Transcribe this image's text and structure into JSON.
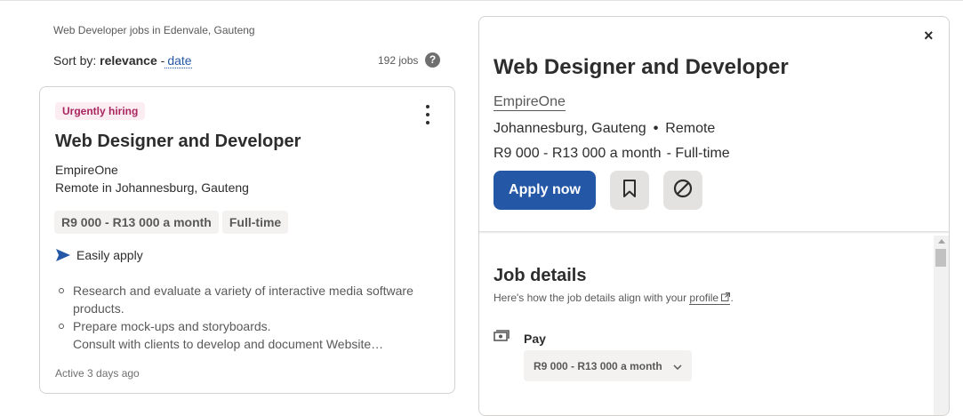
{
  "search": {
    "title": "Web Developer jobs in Edenvale, Gauteng",
    "sort_prefix": "Sort by:",
    "sort_active": "relevance",
    "sort_separator": " -",
    "sort_alt": "date",
    "job_count": "192 jobs",
    "help_glyph": "?"
  },
  "card": {
    "badge": "Urgently hiring",
    "title": "Web Designer and Developer",
    "company": "EmpireOne",
    "location": "Remote in Johannesburg, Gauteng",
    "tags": [
      "R9 000 - R13 000 a month",
      "Full-time"
    ],
    "easy_apply": "Easily apply",
    "snippet": [
      "Research and evaluate a variety of interactive media software products.",
      "Prepare mock-ups and storyboards.",
      "Consult with clients to develop and document Website…"
    ],
    "posted": "Active 3 days ago"
  },
  "detail": {
    "close_glyph": "×",
    "title": "Web Designer and Developer",
    "company": "EmpireOne",
    "location": "Johannesburg, Gauteng",
    "location_sep": "•",
    "work_mode": "Remote",
    "salary": "R9 000 - R13 000 a month",
    "job_type": "- Full-time",
    "apply_label": "Apply now",
    "details_heading": "Job details",
    "details_sub_prefix": "Here's how the job details align with your ",
    "details_sub_link": "profile",
    "details_sub_suffix": ".",
    "pay_label": "Pay",
    "pay_value": "R9 000 - R13 000 a month"
  },
  "colors": {
    "accent": "#2557a7",
    "badge_bg": "#fcedf3",
    "badge_text": "#a9265f",
    "tag_bg": "#f3f2f1"
  },
  "icons": {
    "help": "question-circle-icon",
    "kebab": "more-vertical-icon",
    "easy_apply": "paper-plane-icon",
    "close": "close-icon",
    "save": "bookmark-icon",
    "not_interested": "block-icon",
    "pay": "money-icon",
    "external": "external-link-icon",
    "dropdown": "chevron-down-icon"
  }
}
